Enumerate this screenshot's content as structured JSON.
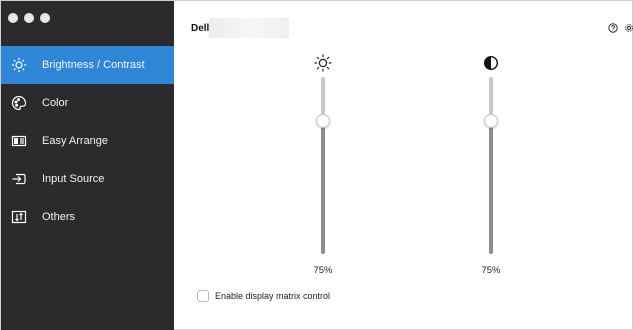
{
  "window": {
    "traffic_lights": [
      "close",
      "minimize",
      "zoom"
    ]
  },
  "sidebar": {
    "items": [
      {
        "label": "Brightness / Contrast",
        "icon": "sun-icon",
        "active": true
      },
      {
        "label": "Color",
        "icon": "palette-icon",
        "active": false
      },
      {
        "label": "Easy Arrange",
        "icon": "layout-icon",
        "active": false
      },
      {
        "label": "Input Source",
        "icon": "input-icon",
        "active": false
      },
      {
        "label": "Others",
        "icon": "sort-icon",
        "active": false
      }
    ],
    "active_color": "#2f86d6",
    "background_color": "#2b2b2d"
  },
  "header": {
    "brand": "Dell",
    "icons": [
      "help-icon",
      "gear-icon"
    ]
  },
  "brightness": {
    "icon": "sun-icon",
    "value_text": "75%",
    "level": 0.75
  },
  "contrast": {
    "icon": "contrast-icon",
    "value_text": "75%",
    "level": 0.75
  },
  "matrix_control": {
    "label": "Enable display matrix control",
    "checked": false
  }
}
